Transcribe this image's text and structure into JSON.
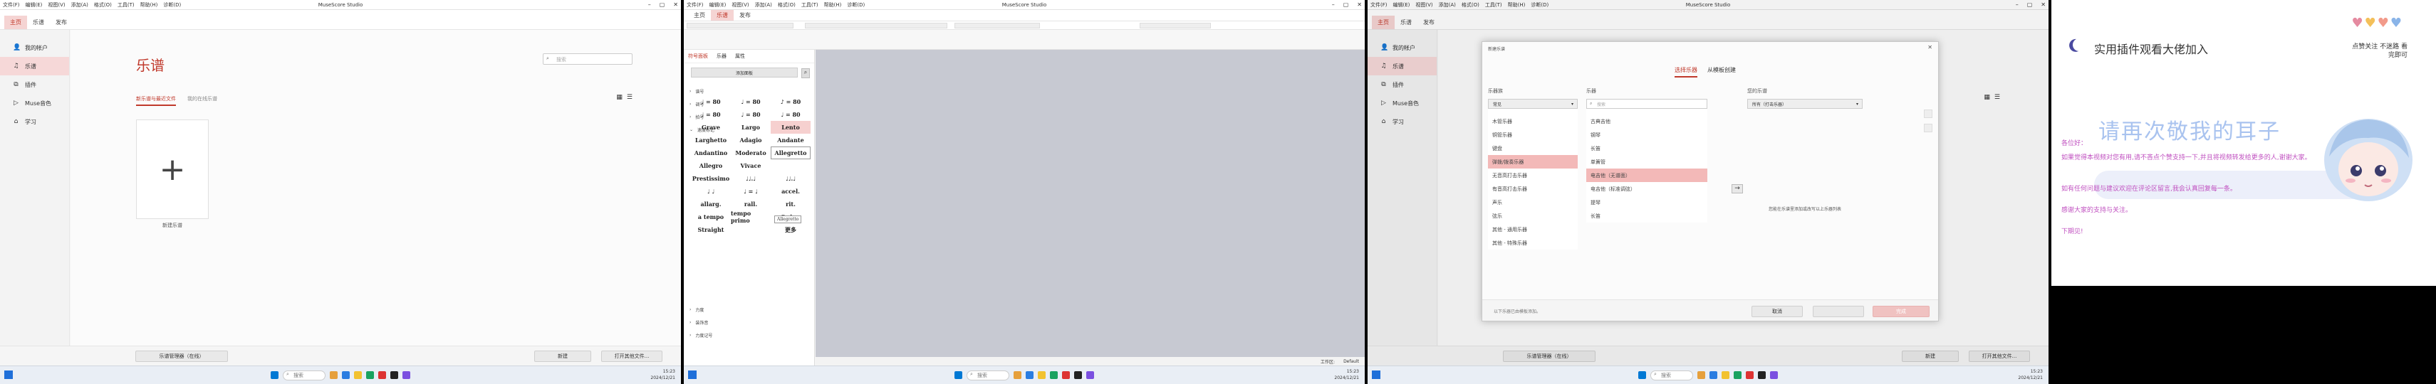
{
  "app": {
    "menus": [
      "文件(F)",
      "编辑(E)",
      "视图(V)",
      "添加(A)",
      "格式(O)",
      "工具(T)",
      "帮助(H)",
      "诊断(D)"
    ],
    "window_title": "MuseScore Studio",
    "tabs": [
      "主页",
      "乐谱",
      "发布"
    ]
  },
  "home": {
    "sidebar": [
      {
        "icon": "user-icon",
        "glyph": "👤",
        "label": "我的帐户"
      },
      {
        "icon": "music-note-icon",
        "glyph": "♫",
        "label": "乐谱"
      },
      {
        "icon": "puzzle-icon",
        "glyph": "⧉",
        "label": "插件"
      },
      {
        "icon": "play-icon",
        "glyph": "▷",
        "label": "Muse音色"
      },
      {
        "icon": "graduation-icon",
        "glyph": "⌂",
        "label": "学习"
      }
    ],
    "page_title": "乐谱",
    "search_placeholder": "搜索",
    "subtabs": [
      "新乐谱与最近文件",
      "我的在线乐谱"
    ],
    "new_score_label": "新建乐谱",
    "btn_score_manager": "乐谱管理器（在线）",
    "btn_new": "新建",
    "btn_open_other": "打开其他文件..."
  },
  "editor": {
    "palette_tabs": [
      "符号面板",
      "乐器",
      "属性"
    ],
    "add_palette": "添加面板",
    "sections_top": [
      "谱号",
      "调号",
      "拍号"
    ],
    "open_section": "速度标记",
    "tempo_cells": [
      "♩ = 80",
      "♩ = 80",
      "♪ = 80",
      "♩ = 80",
      "♩ = 80",
      "♩ = 80",
      "Grave",
      "Largo",
      "Lento",
      "Larghetto",
      "Adagio",
      "Andante",
      "Andantino",
      "Moderato",
      "Allegretto",
      "Allegro",
      "Vivace",
      "",
      "Prestissimo",
      "♩♩.♩",
      "♩♩.♩",
      "♩ ♩",
      "♩ = ♩",
      "accel.",
      "allarg.",
      "rall.",
      "rit.",
      "a tempo",
      "tempo primo",
      "Swing",
      "Straight",
      "",
      "更多"
    ],
    "selected_cell": "Lento",
    "hover_cell": "Allegretto",
    "tooltip": "Allegretto",
    "sections_bottom": [
      "力度",
      "装饰音",
      "力度记号"
    ],
    "status_workspace_label": "工作区:",
    "status_workspace": "Default"
  },
  "dialog": {
    "title": "新建乐谱",
    "tabs": [
      "选择乐器",
      "从模板创建"
    ],
    "family_header": "乐器族",
    "family_select": "常见",
    "families": [
      "木管乐器",
      "铜管乐器",
      "键盘",
      "弹拨/拨奏乐器",
      "无音高打击乐器",
      "有音高打击乐器",
      "声乐",
      "弦乐",
      "其他 - 通用乐器",
      "其他 - 特殊乐器"
    ],
    "selected_family": "弹拨/拨奏乐器",
    "instr_header": "乐器",
    "instr_search": "搜索",
    "instruments": [
      "古典吉他",
      "钢琴",
      "长笛",
      "单簧管",
      "电吉他（无谱面）",
      "电吉他（标准调弦）",
      "提琴",
      "长笛"
    ],
    "selected_instr": "电吉他（无谱面）",
    "score_header": "您的乐谱",
    "score_select": "所有（打击乐器）",
    "empty_msg": "您能在乐谱里添加或改写以上乐器列表",
    "hint": "以下乐器已由模板添加。",
    "btn_cancel": "取消",
    "btn_done": "完成"
  },
  "taskbar": {
    "search": "搜索",
    "time": "15:23",
    "date": "2024/12/21"
  },
  "poster": {
    "title": "实用插件观看大佬加入",
    "caption": "点赞关注 不迷路 看完即可",
    "watermark": "请再次敬我的耳子",
    "lines": [
      "各位好：",
      "如果觉得本视频对您有用,请不吝点个赞支持一下,并且将视频转发给更多的人,谢谢大家。",
      "如有任何问题与建议欢迎在评论区留言,我会认真回复每一条。",
      "感谢大家的支持与关注。",
      "下期见!"
    ]
  },
  "colors": {
    "accent": "#c0392b",
    "selection": "#f6d8d8",
    "canvas": "#c7c9d2"
  }
}
